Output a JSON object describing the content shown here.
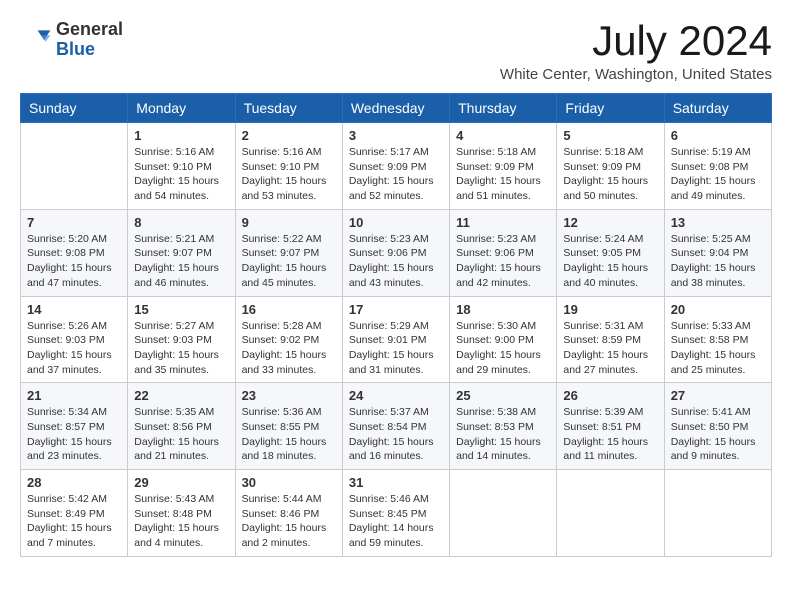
{
  "logo": {
    "general": "General",
    "blue": "Blue"
  },
  "title": "July 2024",
  "location": "White Center, Washington, United States",
  "days": [
    "Sunday",
    "Monday",
    "Tuesday",
    "Wednesday",
    "Thursday",
    "Friday",
    "Saturday"
  ],
  "weeks": [
    [
      {
        "day": "",
        "info": ""
      },
      {
        "day": "1",
        "info": "Sunrise: 5:16 AM\nSunset: 9:10 PM\nDaylight: 15 hours\nand 54 minutes."
      },
      {
        "day": "2",
        "info": "Sunrise: 5:16 AM\nSunset: 9:10 PM\nDaylight: 15 hours\nand 53 minutes."
      },
      {
        "day": "3",
        "info": "Sunrise: 5:17 AM\nSunset: 9:09 PM\nDaylight: 15 hours\nand 52 minutes."
      },
      {
        "day": "4",
        "info": "Sunrise: 5:18 AM\nSunset: 9:09 PM\nDaylight: 15 hours\nand 51 minutes."
      },
      {
        "day": "5",
        "info": "Sunrise: 5:18 AM\nSunset: 9:09 PM\nDaylight: 15 hours\nand 50 minutes."
      },
      {
        "day": "6",
        "info": "Sunrise: 5:19 AM\nSunset: 9:08 PM\nDaylight: 15 hours\nand 49 minutes."
      }
    ],
    [
      {
        "day": "7",
        "info": "Sunrise: 5:20 AM\nSunset: 9:08 PM\nDaylight: 15 hours\nand 47 minutes."
      },
      {
        "day": "8",
        "info": "Sunrise: 5:21 AM\nSunset: 9:07 PM\nDaylight: 15 hours\nand 46 minutes."
      },
      {
        "day": "9",
        "info": "Sunrise: 5:22 AM\nSunset: 9:07 PM\nDaylight: 15 hours\nand 45 minutes."
      },
      {
        "day": "10",
        "info": "Sunrise: 5:23 AM\nSunset: 9:06 PM\nDaylight: 15 hours\nand 43 minutes."
      },
      {
        "day": "11",
        "info": "Sunrise: 5:23 AM\nSunset: 9:06 PM\nDaylight: 15 hours\nand 42 minutes."
      },
      {
        "day": "12",
        "info": "Sunrise: 5:24 AM\nSunset: 9:05 PM\nDaylight: 15 hours\nand 40 minutes."
      },
      {
        "day": "13",
        "info": "Sunrise: 5:25 AM\nSunset: 9:04 PM\nDaylight: 15 hours\nand 38 minutes."
      }
    ],
    [
      {
        "day": "14",
        "info": "Sunrise: 5:26 AM\nSunset: 9:03 PM\nDaylight: 15 hours\nand 37 minutes."
      },
      {
        "day": "15",
        "info": "Sunrise: 5:27 AM\nSunset: 9:03 PM\nDaylight: 15 hours\nand 35 minutes."
      },
      {
        "day": "16",
        "info": "Sunrise: 5:28 AM\nSunset: 9:02 PM\nDaylight: 15 hours\nand 33 minutes."
      },
      {
        "day": "17",
        "info": "Sunrise: 5:29 AM\nSunset: 9:01 PM\nDaylight: 15 hours\nand 31 minutes."
      },
      {
        "day": "18",
        "info": "Sunrise: 5:30 AM\nSunset: 9:00 PM\nDaylight: 15 hours\nand 29 minutes."
      },
      {
        "day": "19",
        "info": "Sunrise: 5:31 AM\nSunset: 8:59 PM\nDaylight: 15 hours\nand 27 minutes."
      },
      {
        "day": "20",
        "info": "Sunrise: 5:33 AM\nSunset: 8:58 PM\nDaylight: 15 hours\nand 25 minutes."
      }
    ],
    [
      {
        "day": "21",
        "info": "Sunrise: 5:34 AM\nSunset: 8:57 PM\nDaylight: 15 hours\nand 23 minutes."
      },
      {
        "day": "22",
        "info": "Sunrise: 5:35 AM\nSunset: 8:56 PM\nDaylight: 15 hours\nand 21 minutes."
      },
      {
        "day": "23",
        "info": "Sunrise: 5:36 AM\nSunset: 8:55 PM\nDaylight: 15 hours\nand 18 minutes."
      },
      {
        "day": "24",
        "info": "Sunrise: 5:37 AM\nSunset: 8:54 PM\nDaylight: 15 hours\nand 16 minutes."
      },
      {
        "day": "25",
        "info": "Sunrise: 5:38 AM\nSunset: 8:53 PM\nDaylight: 15 hours\nand 14 minutes."
      },
      {
        "day": "26",
        "info": "Sunrise: 5:39 AM\nSunset: 8:51 PM\nDaylight: 15 hours\nand 11 minutes."
      },
      {
        "day": "27",
        "info": "Sunrise: 5:41 AM\nSunset: 8:50 PM\nDaylight: 15 hours\nand 9 minutes."
      }
    ],
    [
      {
        "day": "28",
        "info": "Sunrise: 5:42 AM\nSunset: 8:49 PM\nDaylight: 15 hours\nand 7 minutes."
      },
      {
        "day": "29",
        "info": "Sunrise: 5:43 AM\nSunset: 8:48 PM\nDaylight: 15 hours\nand 4 minutes."
      },
      {
        "day": "30",
        "info": "Sunrise: 5:44 AM\nSunset: 8:46 PM\nDaylight: 15 hours\nand 2 minutes."
      },
      {
        "day": "31",
        "info": "Sunrise: 5:46 AM\nSunset: 8:45 PM\nDaylight: 14 hours\nand 59 minutes."
      },
      {
        "day": "",
        "info": ""
      },
      {
        "day": "",
        "info": ""
      },
      {
        "day": "",
        "info": ""
      }
    ]
  ]
}
